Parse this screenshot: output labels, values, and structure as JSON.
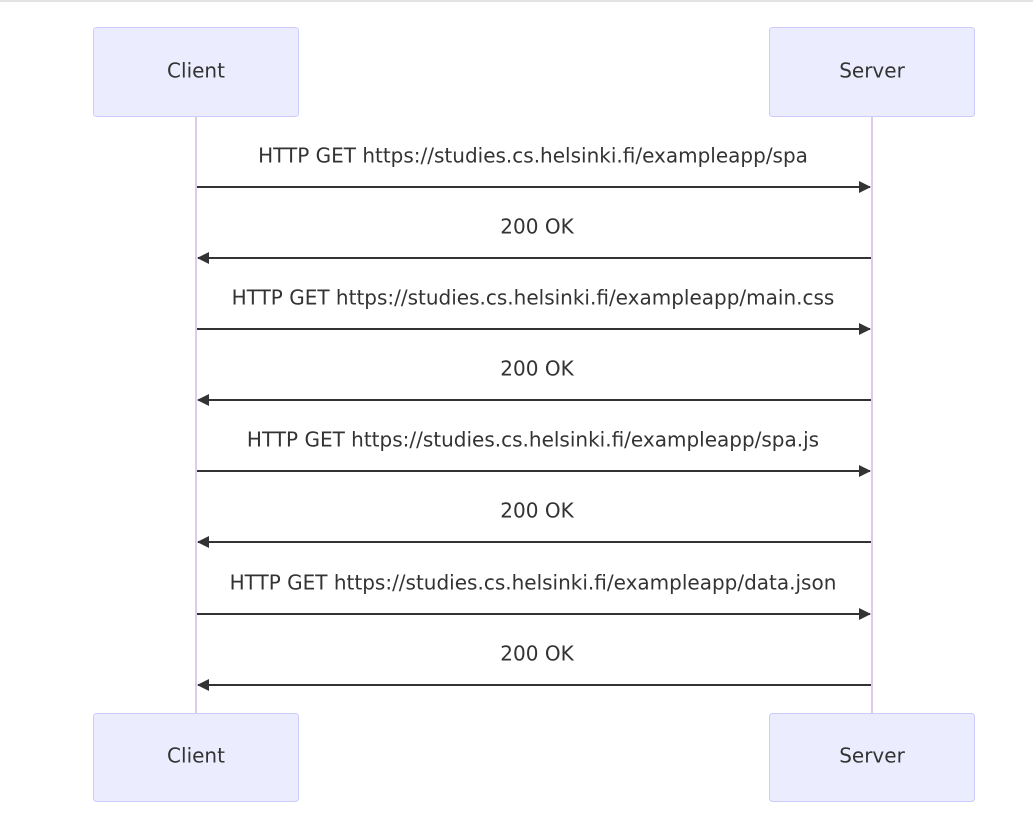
{
  "diagram": {
    "participants": [
      {
        "id": "client",
        "label": "Client"
      },
      {
        "id": "server",
        "label": "Server"
      }
    ],
    "messages": [
      {
        "from": "client",
        "to": "server",
        "text": "HTTP GET https://studies.cs.helsinki.fi/exampleapp/spa"
      },
      {
        "from": "server",
        "to": "client",
        "text": "200 OK"
      },
      {
        "from": "client",
        "to": "server",
        "text": "HTTP GET https://studies.cs.helsinki.fi/exampleapp/main.css"
      },
      {
        "from": "server",
        "to": "client",
        "text": "200 OK"
      },
      {
        "from": "client",
        "to": "server",
        "text": "HTTP GET https://studies.cs.helsinki.fi/exampleapp/spa.js"
      },
      {
        "from": "server",
        "to": "client",
        "text": "200 OK"
      },
      {
        "from": "client",
        "to": "server",
        "text": "HTTP GET https://studies.cs.helsinki.fi/exampleapp/data.json"
      },
      {
        "from": "server",
        "to": "client",
        "text": "200 OK"
      }
    ]
  },
  "colors": {
    "actor_fill": "#ECECFF",
    "actor_stroke": "#CCCCFF",
    "lifeline": "#DCCCEB",
    "arrow": "#333333",
    "text": "#333333",
    "top_border": "#E3E3E3"
  }
}
